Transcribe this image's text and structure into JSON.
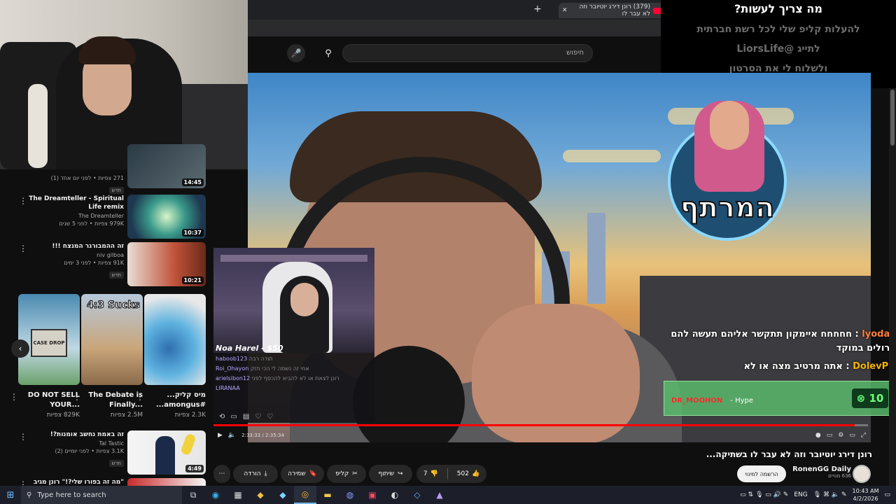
{
  "browser": {
    "tab_title": "(379) רונן דירג יוטיובר וזה לא עבר לו",
    "new_tab_symbol": "+",
    "close_symbol": "✕"
  },
  "youtube": {
    "search_placeholder": "חיפוש"
  },
  "overlay": {
    "line1": "מה צריך לעשות?",
    "line2": "להעלות קליפ שלי לכל רשת חברתית",
    "line3": "לתייג @LiorsLife",
    "line4": "ולשלוח לי את הסרטון"
  },
  "video": {
    "logo_text": "המרתף",
    "donation": "Noa Harel - $50",
    "pip_chat": [
      {
        "user": "haboob123",
        "msg": "תודה רבה"
      },
      {
        "user": "Roi_Ohayon",
        "msg": "אחי זה נשמה לי הכי חזק"
      },
      {
        "user": "arielsibon12",
        "msg": "רונן לצאת או לא להביא להכסף לפני"
      },
      {
        "user": "LIRANAA",
        "msg": ""
      }
    ],
    "chat_overlay": [
      {
        "user": "lyodaa",
        "msg": "חחחחח איימקון תתקשר אליהם תעשה להם טרולים במוקד"
      },
      {
        "user": "DolevPN",
        "msg": "אתה מרטיב מצה או לא"
      }
    ],
    "hype_user": "DR_MOOHON",
    "hype_label": "- Hype",
    "hype_count": "10",
    "time": "2:33:33 / 2:35:34",
    "progress": 0.98,
    "title": "רונן דירג יוטיובר וזה לא עבר לו בשתיקה..."
  },
  "channel": {
    "name": "RonenGG Daily",
    "subs": "636 מנויים",
    "subscribe_label": "הרשמה למינוי"
  },
  "actions": {
    "likes": "502",
    "dislikes": "7",
    "share": "שיתוף",
    "clip": "קליפ",
    "save": "שמירה",
    "download": "הורדה"
  },
  "recommendations": [
    {
      "title": "",
      "channel": "",
      "meta": "271 צפיות • לפני יום אחד (1)",
      "badge": "חדש",
      "duration": "14:45"
    },
    {
      "title": "The Dreamteller - Spiritual Life remix",
      "channel": "The Dreamteller",
      "meta": "979K צפיות • לפני 5 שנים",
      "badge": "",
      "duration": "10:37"
    },
    {
      "title": "זה ההמבורגר המנצח !!!",
      "channel": "niv gilboa",
      "meta": "91K צפיות • לפני 3 ימים",
      "badge": "חדש",
      "duration": "10:21"
    },
    {
      "title": "זה באמת נחשב אומנות?!",
      "channel": "Tal Tastic",
      "meta": "3.1K צפיות • לפני יומיים (2)",
      "badge": "חדש",
      "duration": "4:49"
    },
    {
      "title": "\"מה זה בפורו שלי?!\" רונן מגיב",
      "channel": "",
      "meta": "",
      "badge": "",
      "duration": ""
    }
  ],
  "shorts": [
    {
      "title": "DO NOT SELL YOUR...",
      "views": "829K צפיות",
      "thumb_text": "CASE DROP"
    },
    {
      "title": "The Debate is Finally...",
      "views": "2.5M צפיות",
      "thumb_text": "4:3 Sucks"
    },
    {
      "title": "מיס קליק... #amongus...",
      "views": "2.3K צפיות",
      "thumb_text": ""
    }
  ],
  "taskbar": {
    "search_placeholder": "Type here to search",
    "lang": "ENG",
    "time": "10:43 AM",
    "date": "4/2/2026"
  }
}
